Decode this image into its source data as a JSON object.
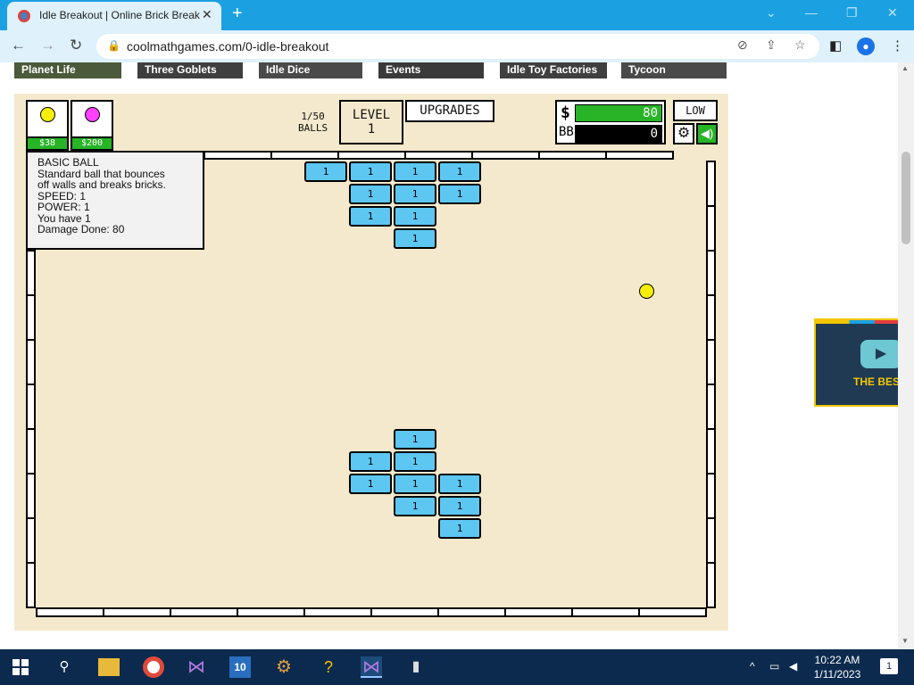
{
  "browser": {
    "tab_title": "Idle Breakout | Online Brick Breaker",
    "tab_close": "✕",
    "new_tab": "+",
    "url": "coolmathgames.com/0-idle-breakout",
    "back": "←",
    "forward": "→",
    "reload": "↻",
    "lock": "🔒",
    "win_minimize": "—",
    "win_restore": "❐",
    "win_close": "✕",
    "win_chevron": "⌄"
  },
  "game_strip": [
    "Planet Life",
    "Three Goblets",
    "Idle Dice",
    "Events",
    "Idle Toy Factories",
    "Tycoon"
  ],
  "hud": {
    "ball_shop": [
      {
        "name": "basic-ball",
        "color": "#f5ee08",
        "price": "$38"
      },
      {
        "name": "plasma-ball",
        "color": "#ff40ff",
        "price": "$200"
      }
    ],
    "balls_count": "1/50",
    "balls_label": "BALLS",
    "level_label": "LEVEL",
    "level_value": "1",
    "upgrades_label": "UPGRADES",
    "money_symbol": "$",
    "money_value": "80",
    "bb_label": "BB",
    "bb_value": "0",
    "quality_label": "LOW"
  },
  "info": {
    "title": "BASIC BALL",
    "desc1": "Standard ball that bounces",
    "desc2": "off walls and breaks bricks.",
    "speed": "SPEED: 1",
    "power": "POWER: 1",
    "have": "You have 1",
    "damage": "Damage Done: 80"
  },
  "bricks": [
    {
      "col": 0,
      "row": 0,
      "value": "1"
    },
    {
      "col": 1,
      "row": 0,
      "value": "1"
    },
    {
      "col": 2,
      "row": 0,
      "value": "1"
    },
    {
      "col": 3,
      "row": 0,
      "value": "1"
    },
    {
      "col": 1,
      "row": 1,
      "value": "1"
    },
    {
      "col": 2,
      "row": 1,
      "value": "1"
    },
    {
      "col": 3,
      "row": 1,
      "value": "1"
    },
    {
      "col": 1,
      "row": 2,
      "value": "1"
    },
    {
      "col": 2,
      "row": 2,
      "value": "1"
    },
    {
      "col": 2,
      "row": 3,
      "value": "1"
    },
    {
      "col": 2,
      "row": 12,
      "value": "1"
    },
    {
      "col": 1,
      "row": 13,
      "value": "1"
    },
    {
      "col": 2,
      "row": 13,
      "value": "1"
    },
    {
      "col": 1,
      "row": 14,
      "value": "1"
    },
    {
      "col": 2,
      "row": 14,
      "value": "1"
    },
    {
      "col": 3,
      "row": 14,
      "value": "1"
    },
    {
      "col": 2,
      "row": 15,
      "value": "1"
    },
    {
      "col": 3,
      "row": 15,
      "value": "1"
    },
    {
      "col": 3,
      "row": 16,
      "value": "1"
    }
  ],
  "ad": {
    "text": "THE BES",
    "play": "▶"
  },
  "taskbar": {
    "time": "10:22 AM",
    "date": "1/11/2023",
    "notification_count": "1",
    "search": "⚲"
  }
}
